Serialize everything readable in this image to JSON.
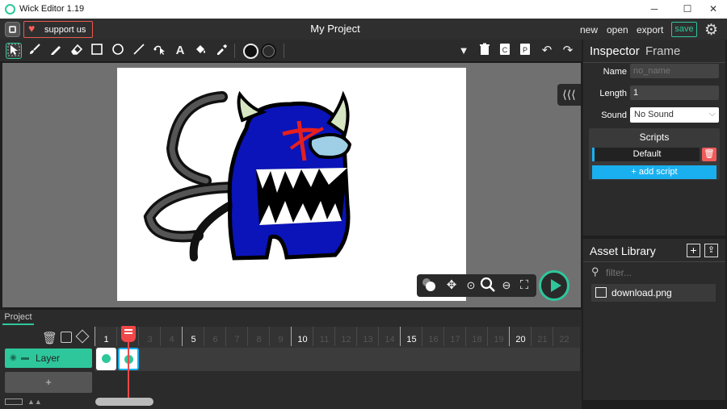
{
  "window": {
    "title": "Wick Editor 1.19",
    "controls": {
      "minimize": "─",
      "maximize": "☐",
      "close": "✕"
    }
  },
  "menubar": {
    "support_label": "support us",
    "project_name": "My Project",
    "new_label": "new",
    "open_label": "open",
    "export_label": "export",
    "save_label": "save"
  },
  "tools": [
    {
      "name": "cursor-tool",
      "glyph": "⬚",
      "active": true
    },
    {
      "name": "brush-tool",
      "glyph": "🖌"
    },
    {
      "name": "pencil-tool",
      "glyph": "✎"
    },
    {
      "name": "eraser-tool",
      "glyph": "⌫"
    },
    {
      "name": "rectangle-tool",
      "glyph": "□"
    },
    {
      "name": "ellipse-tool",
      "glyph": "○"
    },
    {
      "name": "line-tool",
      "glyph": "╱"
    },
    {
      "name": "path-cursor-tool",
      "glyph": "✐"
    },
    {
      "name": "text-tool",
      "glyph": "A"
    },
    {
      "name": "fill-bucket-tool",
      "glyph": "◈"
    },
    {
      "name": "eyedropper-tool",
      "glyph": "✒"
    }
  ],
  "toolbar_right": [
    {
      "name": "more-dropdown-icon",
      "glyph": "▼"
    },
    {
      "name": "delete-icon",
      "glyph": "🗑"
    },
    {
      "name": "copy-icon",
      "glyph": "⧉"
    },
    {
      "name": "paste-icon",
      "glyph": "⎘"
    },
    {
      "name": "undo-icon",
      "glyph": "↶"
    },
    {
      "name": "redo-icon",
      "glyph": "↷"
    }
  ],
  "colors": {
    "accent": "#2ec79b",
    "support_border": "#e85a4f",
    "script_add": "#1ab0f0",
    "script_delete": "#f05a5a",
    "playhead": "#f04848",
    "layer": "#2ec79b"
  },
  "inspector": {
    "title": "Inspector",
    "subtitle": "Frame",
    "name_label": "Name",
    "name_placeholder": "no_name",
    "length_label": "Length",
    "length_value": "1",
    "sound_label": "Sound",
    "sound_value": "No Sound",
    "scripts_title": "Scripts",
    "script_default": "Default",
    "add_script_label": "+ add script"
  },
  "asset_library": {
    "title": "Asset Library",
    "filter_placeholder": "filter...",
    "assets": [
      "download.png"
    ]
  },
  "timeline": {
    "tab_label": "Project",
    "layer_name": "Layer",
    "add_layer_label": "+",
    "frame_numbers": [
      "1",
      "2",
      "3",
      "4",
      "5",
      "6",
      "7",
      "8",
      "9",
      "10",
      "11",
      "12",
      "13",
      "14",
      "15",
      "16",
      "17",
      "18",
      "19",
      "20",
      "21",
      "22"
    ],
    "major_frames": [
      "1",
      "5",
      "10",
      "15",
      "20"
    ]
  }
}
